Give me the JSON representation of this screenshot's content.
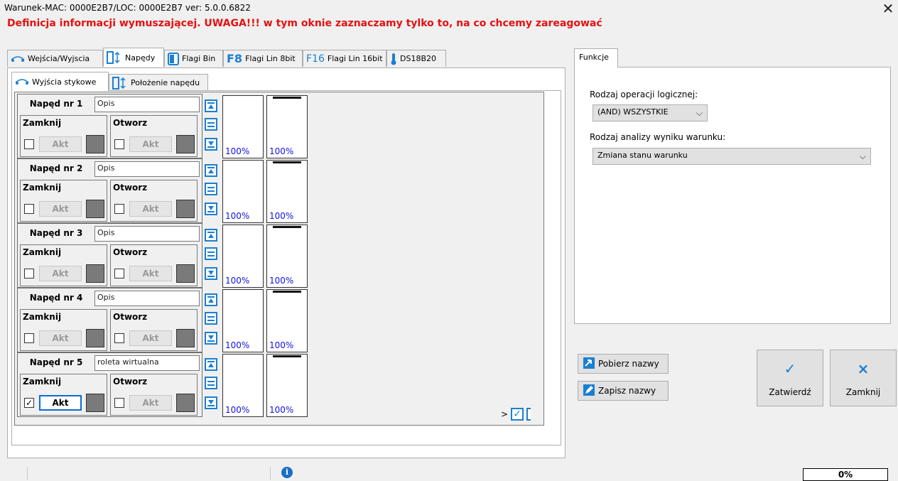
{
  "window": {
    "title": "Warunek-MAC: 0000E2B7/LOC: 0000E2B7 ver: 5.0.0.6822",
    "close_glyph": "✕"
  },
  "warning": "Definicja informacji wymuszającej. UWAGA!!! w tym oknie zaznaczamy tylko to, na co chcemy zareagować",
  "main_tabs": [
    {
      "label": "Wejścia/Wyjscia",
      "icon": "io-icon"
    },
    {
      "label": "Napędy",
      "icon": "drive-icon",
      "active": true
    },
    {
      "label": "Flagi Bin",
      "icon": "flag-bin-icon"
    },
    {
      "label": "Flagi Lin 8bit",
      "icon": "f8-icon",
      "glyph": "F8"
    },
    {
      "label": "Flagi Lin 16bit",
      "icon": "f16-icon",
      "glyph": "F16"
    },
    {
      "label": "DS18B20",
      "icon": "thermometer-icon"
    }
  ],
  "sub_tabs": [
    {
      "label": "Wyjścia stykowe",
      "icon": "io-icon",
      "active": true
    },
    {
      "label": "Położenie napędu",
      "icon": "drive-icon"
    }
  ],
  "drives": [
    {
      "name": "Napęd nr 1",
      "desc": "Opis",
      "close_label": "Zamknij",
      "open_label": "Otworz",
      "close_checked": false,
      "open_checked": false,
      "close_akt": "Akt",
      "open_akt": "Akt",
      "close_active": false,
      "pct1": "100%",
      "pct2": "100%"
    },
    {
      "name": "Napęd nr 2",
      "desc": "Opis",
      "close_label": "Zamknij",
      "open_label": "Otworz",
      "close_checked": false,
      "open_checked": false,
      "close_akt": "Akt",
      "open_akt": "Akt",
      "close_active": false,
      "pct1": "100%",
      "pct2": "100%"
    },
    {
      "name": "Napęd nr 3",
      "desc": "Opis",
      "close_label": "Zamknij",
      "open_label": "Otworz",
      "close_checked": false,
      "open_checked": false,
      "close_akt": "Akt",
      "open_akt": "Akt",
      "close_active": false,
      "pct1": "100%",
      "pct2": "100%"
    },
    {
      "name": "Napęd nr 4",
      "desc": "Opis",
      "close_label": "Zamknij",
      "open_label": "Otworz",
      "close_checked": false,
      "open_checked": false,
      "close_akt": "Akt",
      "open_akt": "Akt",
      "close_active": false,
      "pct1": "100%",
      "pct2": "100%"
    },
    {
      "name": "Napęd nr 5",
      "desc": "roleta wirtualna",
      "close_label": "Zamknij",
      "open_label": "Otworz",
      "close_checked": true,
      "open_checked": false,
      "close_akt": "Akt",
      "open_akt": "Akt",
      "close_active": true,
      "pct1": "100%",
      "pct2": "100%"
    }
  ],
  "nav": {
    "next": ">",
    "check_glyph": "✓"
  },
  "functions": {
    "tab": "Funkcje",
    "op_label": "Rodzaj operacji logicznej:",
    "op_value": "(AND) WSZYSTKIE",
    "analysis_label": "Rodzaj analizy wyniku warunku:",
    "analysis_value": "Zmiana stanu warunku",
    "chevron": "⌵"
  },
  "buttons": {
    "fetch_names": "Pobierz nazwy",
    "save_names": "Zapisz nazwy",
    "confirm": "Zatwierdź",
    "confirm_glyph": "✓",
    "close": "Zamknij",
    "close_glyph": "×"
  },
  "status": {
    "info_glyph": "i",
    "progress": "0%"
  },
  "colors": {
    "warning": "#e81010",
    "accent": "#1b7fd1",
    "percent": "#1212e0"
  }
}
